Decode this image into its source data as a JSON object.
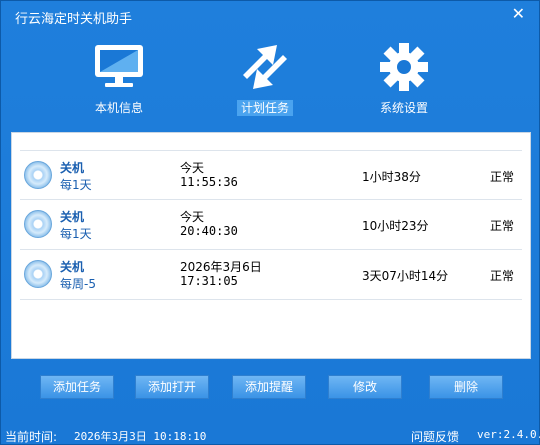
{
  "window": {
    "title": "行云海定时关机助手",
    "close_symbol": "✕"
  },
  "toolbar": {
    "items": [
      {
        "label": "本机信息",
        "icon": "monitor-icon"
      },
      {
        "label": "计划任务",
        "icon": "arrows-icon",
        "active": true
      },
      {
        "label": "系统设置",
        "icon": "gear-icon"
      }
    ]
  },
  "tasks": [
    {
      "action": "关机",
      "frequency": "每1天",
      "day": "今天",
      "time": "11:55:36",
      "remaining": "1小时38分",
      "status": "正常"
    },
    {
      "action": "关机",
      "frequency": "每1天",
      "day": "今天",
      "time": "20:40:30",
      "remaining": "10小时23分",
      "status": "正常"
    },
    {
      "action": "关机",
      "frequency": "每周-5",
      "day": "2026年3月6日",
      "time": "17:31:05",
      "remaining": "3天07小时14分",
      "status": "正常"
    }
  ],
  "buttons": {
    "add_task": "添加任务",
    "add_open": "添加打开",
    "add_reminder": "添加提醒",
    "modify": "修改",
    "delete": "删除"
  },
  "statusbar": {
    "current_time_label": "当前时间:",
    "current_time": "2026年3月3日 10:18:10",
    "feedback": "问题反馈",
    "version": "ver:2.4.0.0"
  },
  "colors": {
    "window_blue": "#1f7fdc",
    "button_blue": "#3a93e6",
    "accent_text": "#1a5fb0"
  }
}
